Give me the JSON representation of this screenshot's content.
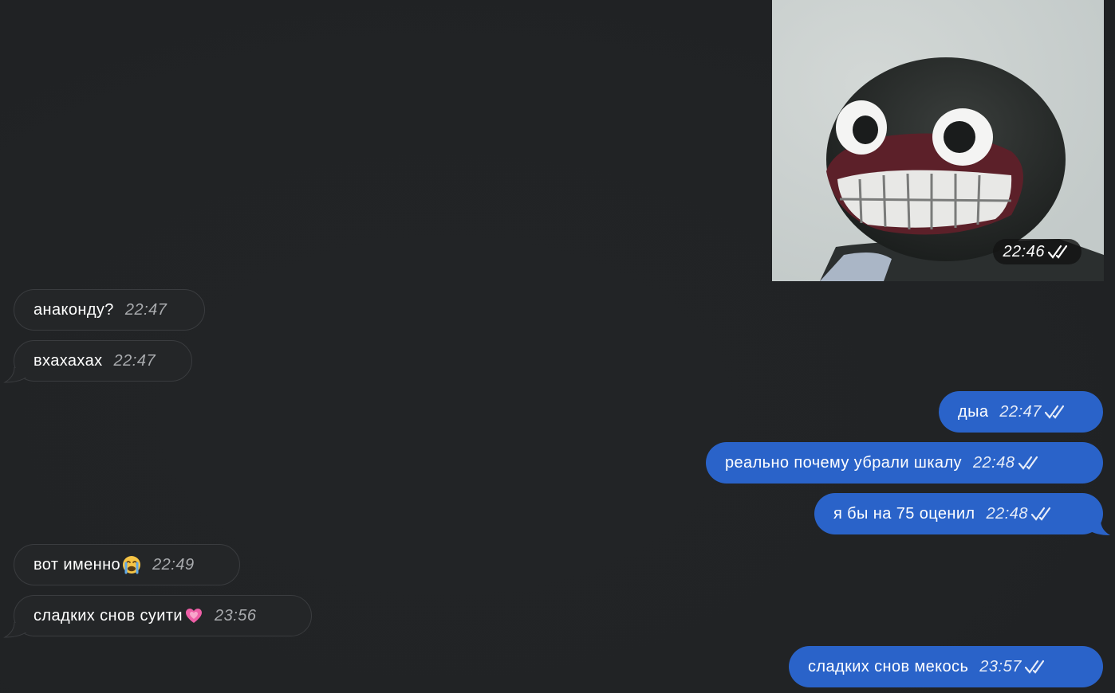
{
  "photo_message": {
    "time": "22:46",
    "status_icon": "double-check-icon"
  },
  "messages": [
    {
      "side": "in",
      "text": "анаконду?",
      "time": "22:47"
    },
    {
      "side": "in",
      "text": "вхахахах",
      "time": "22:47"
    },
    {
      "side": "out",
      "text": "дыа",
      "time": "22:47"
    },
    {
      "side": "out",
      "text": "реально почему убрали шкалу",
      "time": "22:48"
    },
    {
      "side": "out",
      "text": "я бы на 75 оценил",
      "time": "22:48"
    },
    {
      "side": "in",
      "text": "вот именно",
      "emoji": "crying-face",
      "time": "22:49"
    },
    {
      "side": "in",
      "text": "сладких снов суити",
      "emoji": "growing-heart",
      "time": "23:56"
    },
    {
      "side": "out",
      "text": "сладких снов мекось",
      "time": "23:57"
    }
  ],
  "colors": {
    "background": "#232527",
    "incoming_bubble": "#242628",
    "outgoing_bubble": "#2a63c9"
  }
}
